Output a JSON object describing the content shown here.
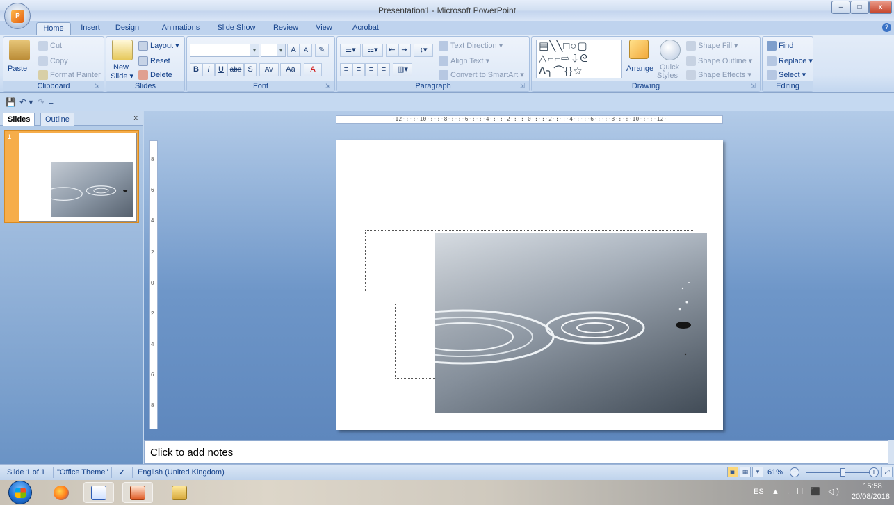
{
  "window": {
    "title": "Presentation1 - Microsoft PowerPoint",
    "office_button_logo": "P",
    "minimize": "–",
    "maximize": "□",
    "close": "x"
  },
  "tabs": [
    "Home",
    "Insert",
    "Design",
    "Animations",
    "Slide Show",
    "Review",
    "View",
    "Acrobat"
  ],
  "active_tab": "Home",
  "ribbon": {
    "clipboard": {
      "label": "Clipboard",
      "paste": "Paste",
      "cut": "Cut",
      "copy": "Copy",
      "format_painter": "Format Painter"
    },
    "slides": {
      "label": "Slides",
      "new_slide": "New",
      "new_slide2": "Slide",
      "layout": "Layout",
      "reset": "Reset",
      "delete": "Delete"
    },
    "font": {
      "label": "Font",
      "bold": "B",
      "italic": "I",
      "underline": "U",
      "strike": "abe",
      "shadow": "S",
      "spacing": "AV",
      "case": "Aa",
      "color": "A",
      "grow": "A",
      "shrink": "A"
    },
    "paragraph": {
      "label": "Paragraph",
      "text_direction": "Text Direction",
      "align_text": "Align Text",
      "convert_smartart": "Convert to SmartArt"
    },
    "drawing": {
      "label": "Drawing",
      "arrange": "Arrange",
      "quick_styles": "Quick",
      "quick_styles2": "Styles",
      "shape_fill": "Shape Fill",
      "shape_outline": "Shape Outline",
      "shape_effects": "Shape Effects",
      "shapes_row1": "▤╲╲□○▢",
      "shapes_row2": "△⌐⌐⇨⇩ᘓ",
      "shapes_row3": "ⴷ╮⌒{}☆"
    },
    "editing": {
      "label": "Editing",
      "find": "Find",
      "replace": "Replace",
      "select": "Select"
    }
  },
  "qat": {
    "save": "💾",
    "undo": "↶ ▾",
    "redo": "↷",
    "customize": "="
  },
  "slides_pane": {
    "tab_slides": "Slides",
    "tab_outline": "Outline",
    "close": "x",
    "thumb_number": "1"
  },
  "ruler": {
    "horizontal": "·12·:·:·10·:·:·8·:·:·6·:·:·4·:·:·2·:·:·0·:·:·2·:·:·4·:·:·6·:·:·8·:·:·10·:·:·12·",
    "vertical": [
      "8",
      "6",
      "4",
      "2",
      "0",
      "2",
      "4",
      "6",
      "8"
    ]
  },
  "notes": {
    "placeholder": "Click to add notes"
  },
  "status": {
    "slide": "Slide 1 of 1",
    "theme": "\"Office Theme\"",
    "language": "English (United Kingdom)",
    "zoom": "61%",
    "zoom_out": "−",
    "zoom_in": "+"
  },
  "taskbar": {
    "lang": "ES",
    "time": "15:58",
    "date": "20/08/2018",
    "tray_icons": "▲ .ıll ⬛ ◁)"
  }
}
